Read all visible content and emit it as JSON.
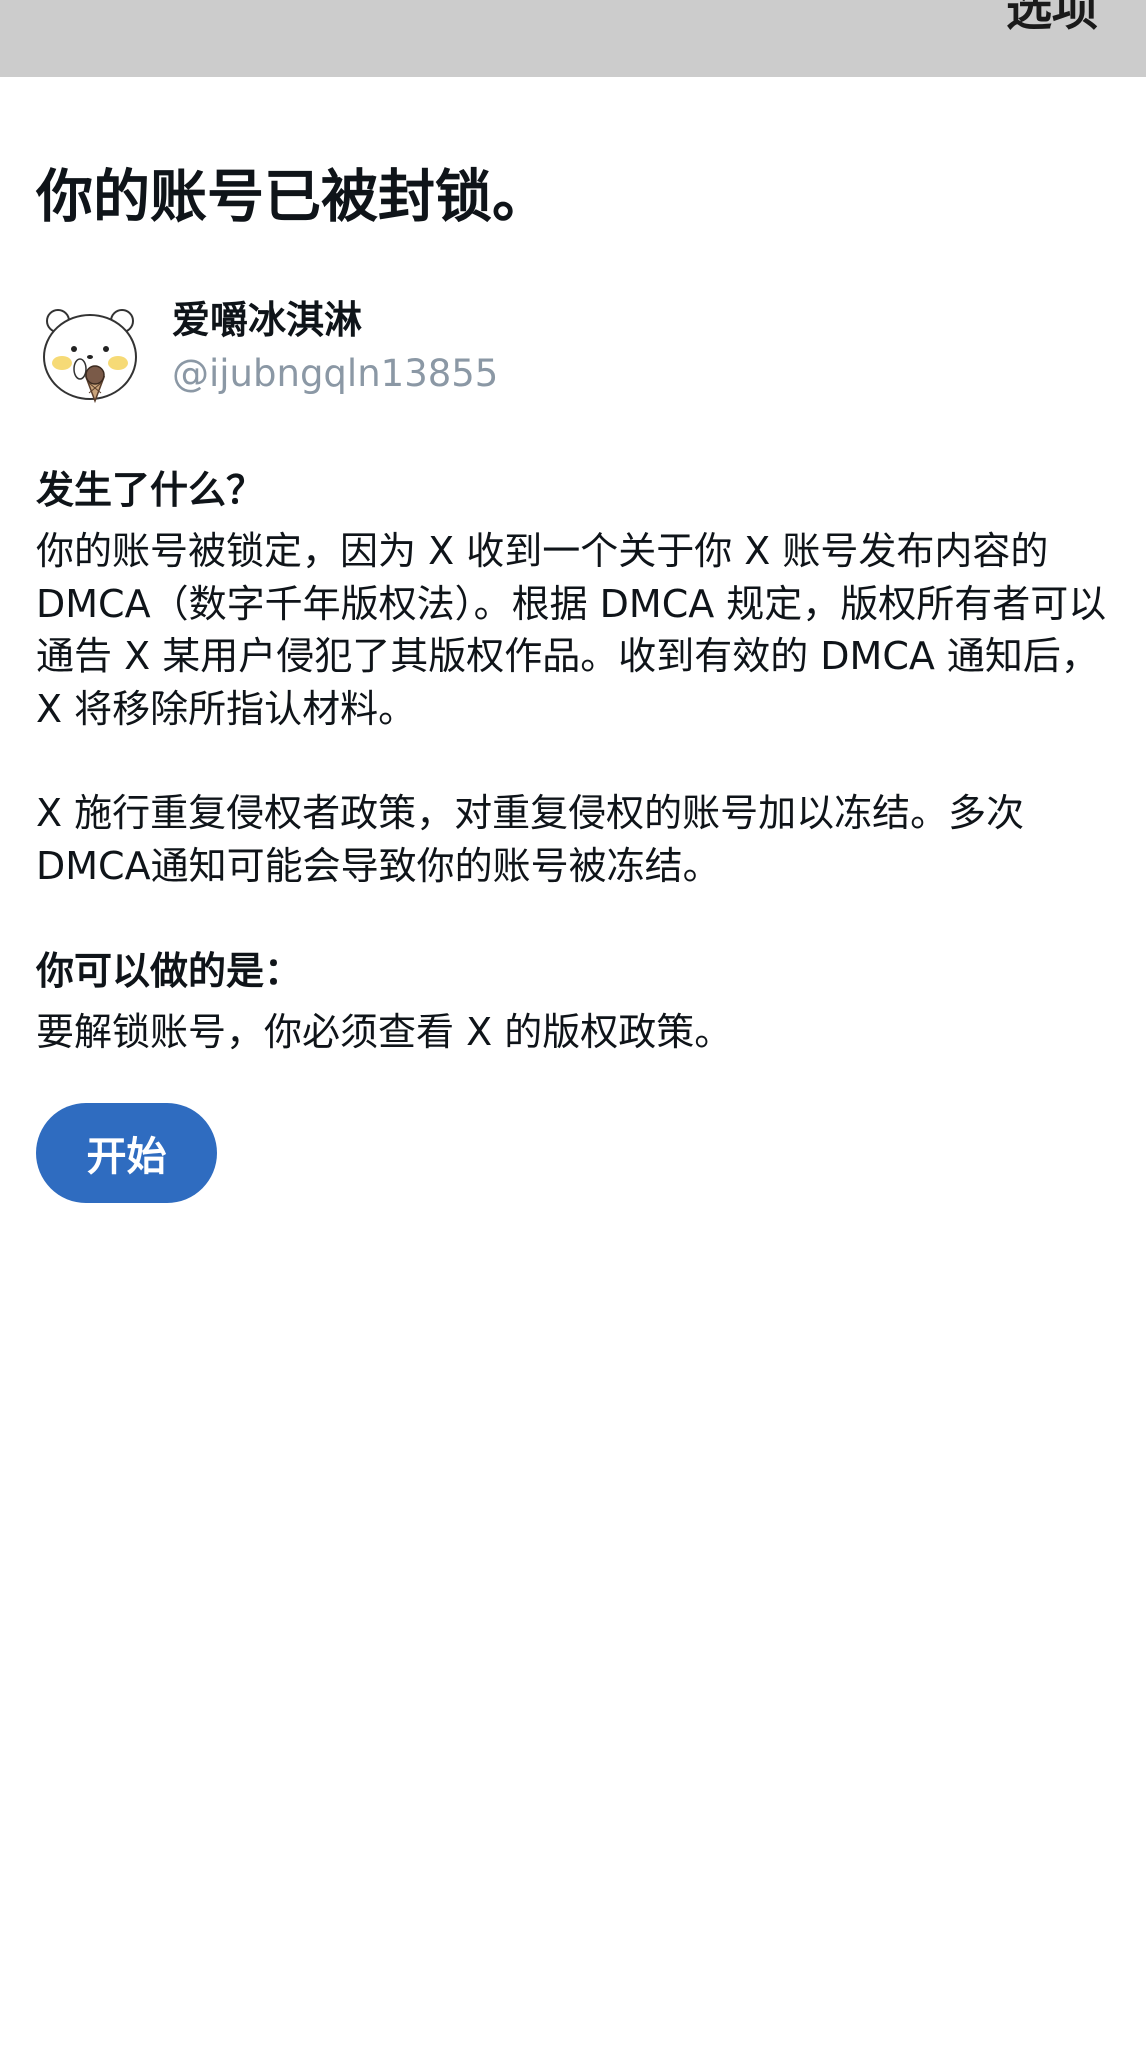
{
  "topbar": {
    "options_label": "选项"
  },
  "page": {
    "title": "你的账号已被封锁。"
  },
  "profile": {
    "display_name": "爱嚼冰淇淋",
    "handle": "@ijubngqln13855",
    "avatar_icon": "bear-avatar-icon"
  },
  "what_happened": {
    "heading": "发生了什么？",
    "paragraph_1": "你的账号被锁定，因为 X 收到一个关于你 X 账号发布内容的 DMCA（数字千年版权法）。根据 DMCA 规定，版权所有者可以通告 X 某用户侵犯了其版权作品。收到有效的 DMCA 通知后，X 将移除所指认材料。",
    "paragraph_2": "X 施行重复侵权者政策，对重复侵权的账号加以冻结。多次 DMCA通知可能会导致你的账号被冻结。"
  },
  "what_you_can_do": {
    "heading": "你可以做的是：",
    "paragraph": "要解锁账号，你必须查看 X 的版权政策。"
  },
  "actions": {
    "start_label": "开始"
  },
  "colors": {
    "topbar_bg": "#cccccc",
    "button_bg": "#2f6cc0",
    "handle_text": "#8b98a5"
  }
}
